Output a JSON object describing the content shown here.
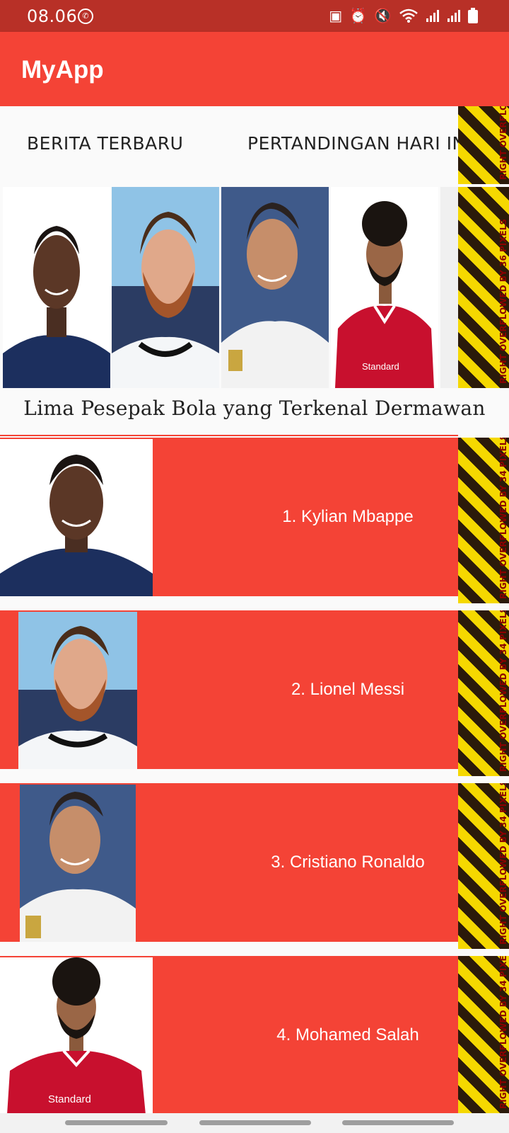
{
  "status_bar": {
    "time": "08.06",
    "icons": [
      "whatsapp-icon",
      "screenshot-icon",
      "alarm-icon",
      "mute-icon",
      "wifi-icon",
      "signal-icon",
      "signal-icon",
      "battery-icon"
    ]
  },
  "app_bar": {
    "title": "MyApp"
  },
  "tabs": [
    {
      "label": "BERITA TERBARU"
    },
    {
      "label": "PERTANDINGAN HARI INI"
    }
  ],
  "gallery": {
    "photos": [
      "kylian-mbappe-photo",
      "lionel-messi-photo",
      "cristiano-ronaldo-photo",
      "mohamed-salah-photo",
      "fifth-player-photo"
    ]
  },
  "section_title": "Lima Pesepak Bola yang Terkenal Dermawan",
  "players": [
    {
      "name": "1. Kylian Mbappe"
    },
    {
      "name": "2. Lionel Messi"
    },
    {
      "name": "3. Cristiano Ronaldo"
    },
    {
      "name": "4. Mohamed Salah"
    }
  ],
  "overflow_labels": [
    "RIGHT OVERFLOWED BY 5.",
    "RIGHT OVERFLOWED BY 36 PIXELS",
    "RIGHT OVERFLOWED BY 34 PIXELS",
    "RIGHT OVERFLOWED BY 34 PIXELS",
    "RIGHT OVERFLOWED BY 34 PIXELS",
    "RIGHT OVERFLOWED BY 34 PIXELS"
  ],
  "colors": {
    "primary": "#f44336",
    "status_bar": "#b83027",
    "overflow_yellow": "#f5d800",
    "overflow_dark": "#2b1a0a",
    "overflow_text": "#8b0000"
  }
}
